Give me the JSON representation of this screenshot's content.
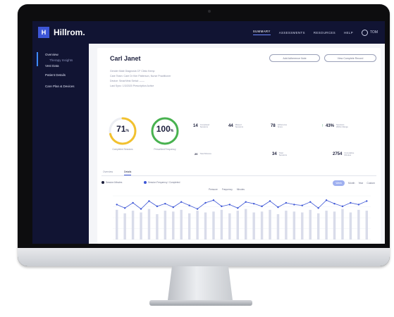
{
  "app": {
    "logo_mark": "H",
    "brand": "Hillrom."
  },
  "nav": {
    "items": [
      "SUMMARY",
      "ASSESSMENTS",
      "RESOURCES",
      "HELP"
    ],
    "user_label": "TOM"
  },
  "sidebar": {
    "items": [
      "Overview",
      "Therapy Insights",
      "Vest Data",
      "Patient Details",
      "Care Plan & Devices"
    ]
  },
  "patient": {
    "name": "Carl Janet",
    "action_left": "Add Adherence Note",
    "action_right": "View Complete Record",
    "info_lines": [
      "Gender Male   Diagnosis CF   Clinic Kemp",
      "Care Team: Care Dr Kim Patterson, Nurse Practitioner",
      "Device: SmartVest   Serial: ——",
      "Last Sync: 1/3/2020   Prescription Active"
    ]
  },
  "gauges": [
    {
      "value": "71",
      "unit": "%",
      "label": "Completed Sessions",
      "percent": 71,
      "color": "#f2c12e"
    },
    {
      "value": "100",
      "unit": "%",
      "label": "Prescribed Frequency",
      "percent": 100,
      "color": "#48b24f"
    }
  ],
  "metrics_top": [
    {
      "value": "14",
      "label": "Completed Sessions"
    },
    {
      "value": "44",
      "label": "Missed Sessions"
    },
    {
      "value": "78",
      "label": "Adherence Score"
    },
    {
      "value": "43%",
      "label": "Sessions Within Range"
    }
  ],
  "metrics_bottom": [
    {
      "value": "20",
      "label": "Total Minutes"
    },
    {
      "value": "34",
      "label": "Total Sessions"
    },
    {
      "value": "2754",
      "label": "Cumulative Minutes"
    }
  ],
  "tabs": [
    "Overview",
    "Details"
  ],
  "legend": [
    {
      "label": "Session Minutes",
      "color": "#1c1f3c"
    },
    {
      "label": "Session Frequency / Completed",
      "color": "#3d56d6"
    }
  ],
  "chart_legend": [
    "Pressure",
    "Frequency",
    "Minutes"
  ],
  "range_toggles": [
    "Week",
    "Month",
    "Year",
    "Custom"
  ],
  "chart_data": {
    "type": "bar",
    "title": "",
    "series": [
      {
        "name": "Bars",
        "values": [
          34,
          30,
          33,
          31,
          35,
          29,
          33,
          32,
          34,
          30,
          33,
          31,
          32,
          34,
          30,
          33,
          35,
          31,
          32,
          34,
          29,
          33,
          32,
          31,
          34,
          30,
          33,
          32,
          35,
          31,
          34,
          33
        ]
      },
      {
        "name": "Line",
        "values": [
          40,
          36,
          42,
          35,
          44,
          38,
          41,
          37,
          43,
          39,
          35,
          42,
          45,
          38,
          40,
          36,
          43,
          41,
          38,
          44,
          37,
          42,
          40,
          39,
          43,
          36,
          45,
          41,
          38,
          42,
          40,
          44
        ]
      }
    ],
    "ylim": [
      0,
      50
    ]
  },
  "colors": {
    "nav_bg": "#111433",
    "accent": "#3d56d6",
    "yellow": "#f2c12e",
    "green": "#48b24f"
  }
}
